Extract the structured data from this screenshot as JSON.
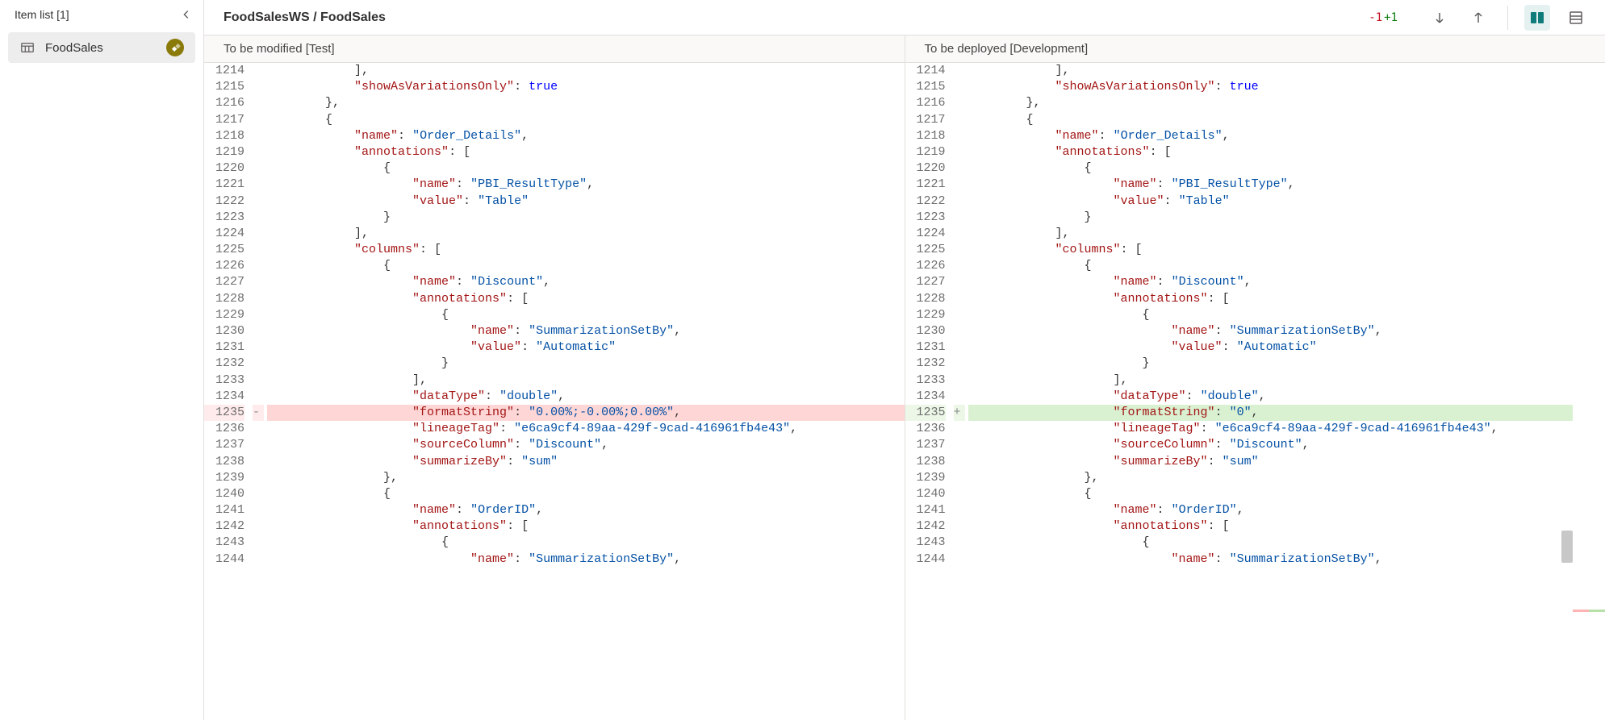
{
  "sidebar": {
    "title": "Item list [1]",
    "item": {
      "label": "FoodSales"
    }
  },
  "header": {
    "breadcrumb": "FoodSalesWS / FoodSales",
    "removed_count": "-1",
    "added_count": "+1"
  },
  "panes": {
    "left_title": "To be modified [Test]",
    "right_title": "To be deployed [Development]"
  },
  "left_lines": [
    {
      "n": "1214",
      "indent": 3,
      "t": [
        {
          "c": "p",
          "v": "],"
        }
      ]
    },
    {
      "n": "1215",
      "indent": 3,
      "t": [
        {
          "c": "k",
          "v": "\"showAsVariationsOnly\""
        },
        {
          "c": "p",
          "v": ": "
        },
        {
          "c": "b",
          "v": "true"
        }
      ]
    },
    {
      "n": "1216",
      "indent": 2,
      "t": [
        {
          "c": "p",
          "v": "},"
        }
      ]
    },
    {
      "n": "1217",
      "indent": 2,
      "t": [
        {
          "c": "p",
          "v": "{"
        }
      ]
    },
    {
      "n": "1218",
      "indent": 3,
      "t": [
        {
          "c": "k",
          "v": "\"name\""
        },
        {
          "c": "p",
          "v": ": "
        },
        {
          "c": "s",
          "v": "\"Order_Details\""
        },
        {
          "c": "p",
          "v": ","
        }
      ]
    },
    {
      "n": "1219",
      "indent": 3,
      "t": [
        {
          "c": "k",
          "v": "\"annotations\""
        },
        {
          "c": "p",
          "v": ": ["
        }
      ]
    },
    {
      "n": "1220",
      "indent": 4,
      "t": [
        {
          "c": "p",
          "v": "{"
        }
      ]
    },
    {
      "n": "1221",
      "indent": 5,
      "t": [
        {
          "c": "k",
          "v": "\"name\""
        },
        {
          "c": "p",
          "v": ": "
        },
        {
          "c": "s",
          "v": "\"PBI_ResultType\""
        },
        {
          "c": "p",
          "v": ","
        }
      ]
    },
    {
      "n": "1222",
      "indent": 5,
      "t": [
        {
          "c": "k",
          "v": "\"value\""
        },
        {
          "c": "p",
          "v": ": "
        },
        {
          "c": "s",
          "v": "\"Table\""
        }
      ]
    },
    {
      "n": "1223",
      "indent": 4,
      "t": [
        {
          "c": "p",
          "v": "}"
        }
      ]
    },
    {
      "n": "1224",
      "indent": 3,
      "t": [
        {
          "c": "p",
          "v": "],"
        }
      ]
    },
    {
      "n": "1225",
      "indent": 3,
      "t": [
        {
          "c": "k",
          "v": "\"columns\""
        },
        {
          "c": "p",
          "v": ": ["
        }
      ]
    },
    {
      "n": "1226",
      "indent": 4,
      "t": [
        {
          "c": "p",
          "v": "{"
        }
      ]
    },
    {
      "n": "1227",
      "indent": 5,
      "t": [
        {
          "c": "k",
          "v": "\"name\""
        },
        {
          "c": "p",
          "v": ": "
        },
        {
          "c": "s",
          "v": "\"Discount\""
        },
        {
          "c": "p",
          "v": ","
        }
      ]
    },
    {
      "n": "1228",
      "indent": 5,
      "t": [
        {
          "c": "k",
          "v": "\"annotations\""
        },
        {
          "c": "p",
          "v": ": ["
        }
      ]
    },
    {
      "n": "1229",
      "indent": 6,
      "t": [
        {
          "c": "p",
          "v": "{"
        }
      ]
    },
    {
      "n": "1230",
      "indent": 7,
      "t": [
        {
          "c": "k",
          "v": "\"name\""
        },
        {
          "c": "p",
          "v": ": "
        },
        {
          "c": "s",
          "v": "\"SummarizationSetBy\""
        },
        {
          "c": "p",
          "v": ","
        }
      ]
    },
    {
      "n": "1231",
      "indent": 7,
      "t": [
        {
          "c": "k",
          "v": "\"value\""
        },
        {
          "c": "p",
          "v": ": "
        },
        {
          "c": "s",
          "v": "\"Automatic\""
        }
      ]
    },
    {
      "n": "1232",
      "indent": 6,
      "t": [
        {
          "c": "p",
          "v": "}"
        }
      ]
    },
    {
      "n": "1233",
      "indent": 5,
      "t": [
        {
          "c": "p",
          "v": "],"
        }
      ]
    },
    {
      "n": "1234",
      "indent": 5,
      "t": [
        {
          "c": "k",
          "v": "\"dataType\""
        },
        {
          "c": "p",
          "v": ": "
        },
        {
          "c": "s",
          "v": "\"double\""
        },
        {
          "c": "p",
          "v": ","
        }
      ]
    },
    {
      "n": "1235",
      "indent": 5,
      "mark": "-",
      "cls": "removed",
      "t": [
        {
          "c": "k",
          "v": "\"formatString\""
        },
        {
          "c": "p",
          "v": ": "
        },
        {
          "c": "s",
          "v": "\"0.00%;-0.00%;0.00%\""
        },
        {
          "c": "p",
          "v": ","
        }
      ]
    },
    {
      "n": "1236",
      "indent": 5,
      "t": [
        {
          "c": "k",
          "v": "\"lineageTag\""
        },
        {
          "c": "p",
          "v": ": "
        },
        {
          "c": "s",
          "v": "\"e6ca9cf4-89aa-429f-9cad-416961fb4e43\""
        },
        {
          "c": "p",
          "v": ","
        }
      ]
    },
    {
      "n": "1237",
      "indent": 5,
      "t": [
        {
          "c": "k",
          "v": "\"sourceColumn\""
        },
        {
          "c": "p",
          "v": ": "
        },
        {
          "c": "s",
          "v": "\"Discount\""
        },
        {
          "c": "p",
          "v": ","
        }
      ]
    },
    {
      "n": "1238",
      "indent": 5,
      "t": [
        {
          "c": "k",
          "v": "\"summarizeBy\""
        },
        {
          "c": "p",
          "v": ": "
        },
        {
          "c": "s",
          "v": "\"sum\""
        }
      ]
    },
    {
      "n": "1239",
      "indent": 4,
      "t": [
        {
          "c": "p",
          "v": "},"
        }
      ]
    },
    {
      "n": "1240",
      "indent": 4,
      "t": [
        {
          "c": "p",
          "v": "{"
        }
      ]
    },
    {
      "n": "1241",
      "indent": 5,
      "t": [
        {
          "c": "k",
          "v": "\"name\""
        },
        {
          "c": "p",
          "v": ": "
        },
        {
          "c": "s",
          "v": "\"OrderID\""
        },
        {
          "c": "p",
          "v": ","
        }
      ]
    },
    {
      "n": "1242",
      "indent": 5,
      "t": [
        {
          "c": "k",
          "v": "\"annotations\""
        },
        {
          "c": "p",
          "v": ": ["
        }
      ]
    },
    {
      "n": "1243",
      "indent": 6,
      "t": [
        {
          "c": "p",
          "v": "{"
        }
      ]
    },
    {
      "n": "1244",
      "indent": 7,
      "t": [
        {
          "c": "k",
          "v": "\"name\""
        },
        {
          "c": "p",
          "v": ": "
        },
        {
          "c": "s",
          "v": "\"SummarizationSetBy\""
        },
        {
          "c": "p",
          "v": ","
        }
      ]
    }
  ],
  "right_lines": [
    {
      "n": "1214",
      "indent": 3,
      "t": [
        {
          "c": "p",
          "v": "],"
        }
      ]
    },
    {
      "n": "1215",
      "indent": 3,
      "t": [
        {
          "c": "k",
          "v": "\"showAsVariationsOnly\""
        },
        {
          "c": "p",
          "v": ": "
        },
        {
          "c": "b",
          "v": "true"
        }
      ]
    },
    {
      "n": "1216",
      "indent": 2,
      "t": [
        {
          "c": "p",
          "v": "},"
        }
      ]
    },
    {
      "n": "1217",
      "indent": 2,
      "t": [
        {
          "c": "p",
          "v": "{"
        }
      ]
    },
    {
      "n": "1218",
      "indent": 3,
      "t": [
        {
          "c": "k",
          "v": "\"name\""
        },
        {
          "c": "p",
          "v": ": "
        },
        {
          "c": "s",
          "v": "\"Order_Details\""
        },
        {
          "c": "p",
          "v": ","
        }
      ]
    },
    {
      "n": "1219",
      "indent": 3,
      "t": [
        {
          "c": "k",
          "v": "\"annotations\""
        },
        {
          "c": "p",
          "v": ": ["
        }
      ]
    },
    {
      "n": "1220",
      "indent": 4,
      "t": [
        {
          "c": "p",
          "v": "{"
        }
      ]
    },
    {
      "n": "1221",
      "indent": 5,
      "t": [
        {
          "c": "k",
          "v": "\"name\""
        },
        {
          "c": "p",
          "v": ": "
        },
        {
          "c": "s",
          "v": "\"PBI_ResultType\""
        },
        {
          "c": "p",
          "v": ","
        }
      ]
    },
    {
      "n": "1222",
      "indent": 5,
      "t": [
        {
          "c": "k",
          "v": "\"value\""
        },
        {
          "c": "p",
          "v": ": "
        },
        {
          "c": "s",
          "v": "\"Table\""
        }
      ]
    },
    {
      "n": "1223",
      "indent": 4,
      "t": [
        {
          "c": "p",
          "v": "}"
        }
      ]
    },
    {
      "n": "1224",
      "indent": 3,
      "t": [
        {
          "c": "p",
          "v": "],"
        }
      ]
    },
    {
      "n": "1225",
      "indent": 3,
      "t": [
        {
          "c": "k",
          "v": "\"columns\""
        },
        {
          "c": "p",
          "v": ": ["
        }
      ]
    },
    {
      "n": "1226",
      "indent": 4,
      "t": [
        {
          "c": "p",
          "v": "{"
        }
      ]
    },
    {
      "n": "1227",
      "indent": 5,
      "t": [
        {
          "c": "k",
          "v": "\"name\""
        },
        {
          "c": "p",
          "v": ": "
        },
        {
          "c": "s",
          "v": "\"Discount\""
        },
        {
          "c": "p",
          "v": ","
        }
      ]
    },
    {
      "n": "1228",
      "indent": 5,
      "t": [
        {
          "c": "k",
          "v": "\"annotations\""
        },
        {
          "c": "p",
          "v": ": ["
        }
      ]
    },
    {
      "n": "1229",
      "indent": 6,
      "t": [
        {
          "c": "p",
          "v": "{"
        }
      ]
    },
    {
      "n": "1230",
      "indent": 7,
      "t": [
        {
          "c": "k",
          "v": "\"name\""
        },
        {
          "c": "p",
          "v": ": "
        },
        {
          "c": "s",
          "v": "\"SummarizationSetBy\""
        },
        {
          "c": "p",
          "v": ","
        }
      ]
    },
    {
      "n": "1231",
      "indent": 7,
      "t": [
        {
          "c": "k",
          "v": "\"value\""
        },
        {
          "c": "p",
          "v": ": "
        },
        {
          "c": "s",
          "v": "\"Automatic\""
        }
      ]
    },
    {
      "n": "1232",
      "indent": 6,
      "t": [
        {
          "c": "p",
          "v": "}"
        }
      ]
    },
    {
      "n": "1233",
      "indent": 5,
      "t": [
        {
          "c": "p",
          "v": "],"
        }
      ]
    },
    {
      "n": "1234",
      "indent": 5,
      "t": [
        {
          "c": "k",
          "v": "\"dataType\""
        },
        {
          "c": "p",
          "v": ": "
        },
        {
          "c": "s",
          "v": "\"double\""
        },
        {
          "c": "p",
          "v": ","
        }
      ]
    },
    {
      "n": "1235",
      "indent": 5,
      "mark": "+",
      "cls": "added",
      "t": [
        {
          "c": "k",
          "v": "\"formatString\""
        },
        {
          "c": "p",
          "v": ": "
        },
        {
          "c": "s",
          "v": "\"0\""
        },
        {
          "c": "p",
          "v": ","
        }
      ]
    },
    {
      "n": "1236",
      "indent": 5,
      "t": [
        {
          "c": "k",
          "v": "\"lineageTag\""
        },
        {
          "c": "p",
          "v": ": "
        },
        {
          "c": "s",
          "v": "\"e6ca9cf4-89aa-429f-9cad-416961fb4e43\""
        },
        {
          "c": "p",
          "v": ","
        }
      ]
    },
    {
      "n": "1237",
      "indent": 5,
      "t": [
        {
          "c": "k",
          "v": "\"sourceColumn\""
        },
        {
          "c": "p",
          "v": ": "
        },
        {
          "c": "s",
          "v": "\"Discount\""
        },
        {
          "c": "p",
          "v": ","
        }
      ]
    },
    {
      "n": "1238",
      "indent": 5,
      "t": [
        {
          "c": "k",
          "v": "\"summarizeBy\""
        },
        {
          "c": "p",
          "v": ": "
        },
        {
          "c": "s",
          "v": "\"sum\""
        }
      ]
    },
    {
      "n": "1239",
      "indent": 4,
      "t": [
        {
          "c": "p",
          "v": "},"
        }
      ]
    },
    {
      "n": "1240",
      "indent": 4,
      "t": [
        {
          "c": "p",
          "v": "{"
        }
      ]
    },
    {
      "n": "1241",
      "indent": 5,
      "t": [
        {
          "c": "k",
          "v": "\"name\""
        },
        {
          "c": "p",
          "v": ": "
        },
        {
          "c": "s",
          "v": "\"OrderID\""
        },
        {
          "c": "p",
          "v": ","
        }
      ]
    },
    {
      "n": "1242",
      "indent": 5,
      "t": [
        {
          "c": "k",
          "v": "\"annotations\""
        },
        {
          "c": "p",
          "v": ": ["
        }
      ]
    },
    {
      "n": "1243",
      "indent": 6,
      "t": [
        {
          "c": "p",
          "v": "{"
        }
      ]
    },
    {
      "n": "1244",
      "indent": 7,
      "t": [
        {
          "c": "k",
          "v": "\"name\""
        },
        {
          "c": "p",
          "v": ": "
        },
        {
          "c": "s",
          "v": "\"SummarizationSetBy\""
        },
        {
          "c": "p",
          "v": ","
        }
      ]
    }
  ]
}
